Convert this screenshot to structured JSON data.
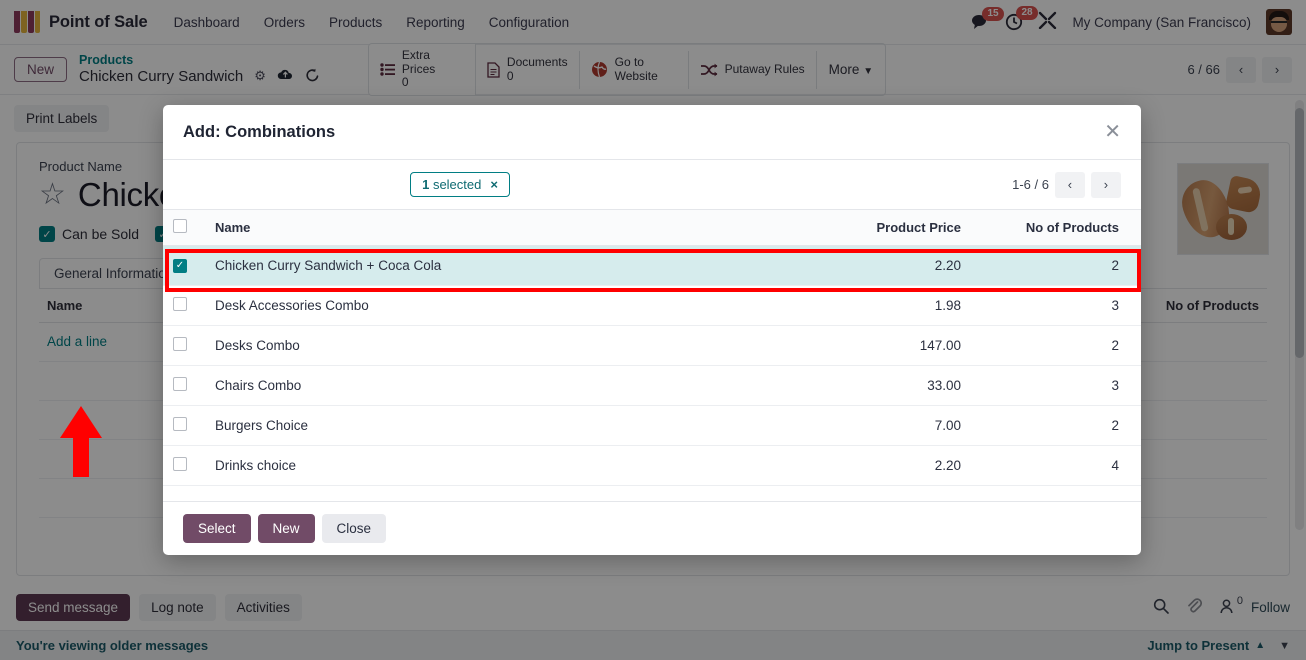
{
  "navbar": {
    "brand": "Point of Sale",
    "links": [
      "Dashboard",
      "Orders",
      "Products",
      "Reporting",
      "Configuration"
    ],
    "messages_count": "15",
    "activities_count": "28",
    "company": "My Company (San Francisco)",
    "icons": [
      "speech-bubble-icon",
      "clock-icon",
      "wrench-icon",
      "avatar"
    ]
  },
  "control_panel": {
    "new_label": "New",
    "breadcrumb_parent": "Products",
    "breadcrumb_current": "Chicken Curry Sandwich",
    "stat_buttons": [
      {
        "label": "Extra Prices",
        "value": "0",
        "icon": "list-icon"
      },
      {
        "label": "Documents",
        "value": "0",
        "icon": "document-icon"
      },
      {
        "label": "Go to Website",
        "value": "",
        "icon": "globe-icon"
      },
      {
        "label": "Putaway Rules",
        "value": "",
        "icon": "shuffle-icon"
      }
    ],
    "more_label": "More",
    "pager_text": "6 / 66"
  },
  "form": {
    "print_labels": "Print Labels",
    "product_name_label": "Product Name",
    "product_name": "Chicken Curry Sandwich",
    "can_be_sold": "Can be Sold",
    "tab_label": "General Information",
    "col_name": "Name",
    "col_no_of_products": "No of Products",
    "add_a_line": "Add a line"
  },
  "chatter": {
    "send_message": "Send message",
    "log_note": "Log note",
    "activities": "Activities",
    "followers_count": "0",
    "follow": "Follow",
    "older_messages": "You're viewing older messages",
    "jump_to_present": "Jump to Present"
  },
  "modal": {
    "title": "Add: Combinations",
    "close_icon": "close-icon",
    "selected_badge": {
      "count": "1",
      "label": "selected",
      "clear_icon": "×"
    },
    "pager_text": "1-6 / 6",
    "columns": [
      "Name",
      "Product Price",
      "No of Products"
    ],
    "rows": [
      {
        "name": "Chicken Curry Sandwich + Coca Cola",
        "price": "2.20",
        "count": "2",
        "selected": true
      },
      {
        "name": "Desk Accessories Combo",
        "price": "1.98",
        "count": "3",
        "selected": false
      },
      {
        "name": "Desks Combo",
        "price": "147.00",
        "count": "2",
        "selected": false
      },
      {
        "name": "Chairs Combo",
        "price": "33.00",
        "count": "3",
        "selected": false
      },
      {
        "name": "Burgers Choice",
        "price": "7.00",
        "count": "2",
        "selected": false
      },
      {
        "name": "Drinks choice",
        "price": "2.20",
        "count": "4",
        "selected": false
      }
    ],
    "footer": {
      "select": "Select",
      "new": "New",
      "close": "Close"
    }
  },
  "colors": {
    "accent_purple": "#714b67",
    "accent_teal": "#017e84",
    "annotation_red": "#ff0000",
    "selected_row_bg": "#d6eced"
  }
}
